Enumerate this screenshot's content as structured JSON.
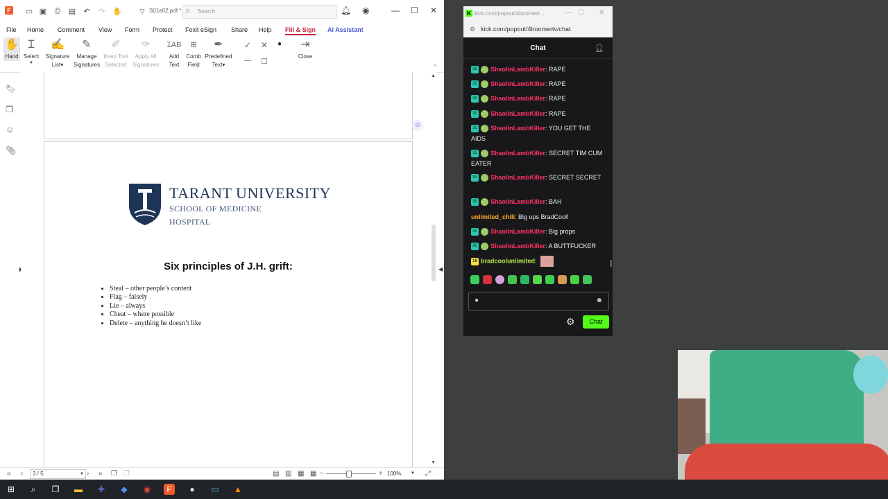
{
  "pdf": {
    "filename": "S01e02.pdf *",
    "search_placeholder": "Search",
    "menu": [
      "File",
      "Home",
      "Comment",
      "View",
      "Form",
      "Protect",
      "Foxit eSign",
      "Share",
      "Help",
      "Fill & Sign",
      "AI Assistant"
    ],
    "active_menu": "Fill & Sign",
    "ribbon": {
      "hand": "Hand",
      "select": "Select",
      "signature_list": [
        "Signature",
        "List"
      ],
      "manage_signatures": [
        "Manage",
        "Signatures"
      ],
      "keep_tool_selected": [
        "Keep Tool",
        "Selected"
      ],
      "apply_all_signatures": [
        "Apply All",
        "Signatures"
      ],
      "add_text": [
        "Add",
        "Text"
      ],
      "comb_field": [
        "Comb",
        "Field"
      ],
      "predefined_text": [
        "Predefined",
        "Text"
      ],
      "close": "Close"
    },
    "document": {
      "university_name": "TARANT UNIVERSITY",
      "school": "SCHOOL OF MEDICINE",
      "hospital": "HOSPITAL",
      "title": "Six principles of J.H. grift:",
      "bullets": [
        "Steal – other people’s content",
        "Flag – falsely",
        "Lie – always",
        "Cheat – where possible",
        "Delete – anything he doesn’t like"
      ]
    },
    "status": {
      "page": "3 / 5",
      "zoom": "100%",
      "zoom_level": 0.45
    }
  },
  "chat": {
    "window_title": "kick.com/popout/4boomert...",
    "url": "kick.com/popout/4boomertv/chat",
    "header": "Chat",
    "messages": [
      {
        "user": "ShaolinLambKiller",
        "text": "RAPE",
        "badge": "3E"
      },
      {
        "user": "ShaolinLambKiller",
        "text": "RAPE",
        "badge": "3E"
      },
      {
        "user": "ShaolinLambKiller",
        "text": "RAPE",
        "badge": "3E"
      },
      {
        "user": "ShaolinLambKiller",
        "text": "RAPE",
        "badge": "3E"
      },
      {
        "user": "ShaolinLambKiller",
        "text": "YOU GET THE AIDS",
        "badge": "3E"
      },
      {
        "user": "ShaolinLambKiller",
        "text": "SECRET TIM CUM EATER",
        "badge": "3E"
      },
      {
        "user": "ShaolinLambKiller",
        "text": "SECRET SECRET",
        "badge": "3E"
      },
      {
        "user": "ShaolinLambKiller",
        "text": "BAH",
        "badge": "3E"
      },
      {
        "user": "unlimited_chili",
        "text": "Big ups BradCool!",
        "badge": ""
      },
      {
        "user": "ShaolinLambKiller",
        "text": "Big props",
        "badge": "3E"
      },
      {
        "user": "ShaolinLambKiller",
        "text": "A BUTTFUCKER",
        "badge": "3E"
      },
      {
        "user": "bradcoolunlimited",
        "text": "",
        "badge": "18"
      }
    ],
    "send_label": "Chat"
  },
  "colors": {
    "kick_green": "#53fc18",
    "foxit_red": "#c8213a",
    "username_red": "#ff3366"
  }
}
